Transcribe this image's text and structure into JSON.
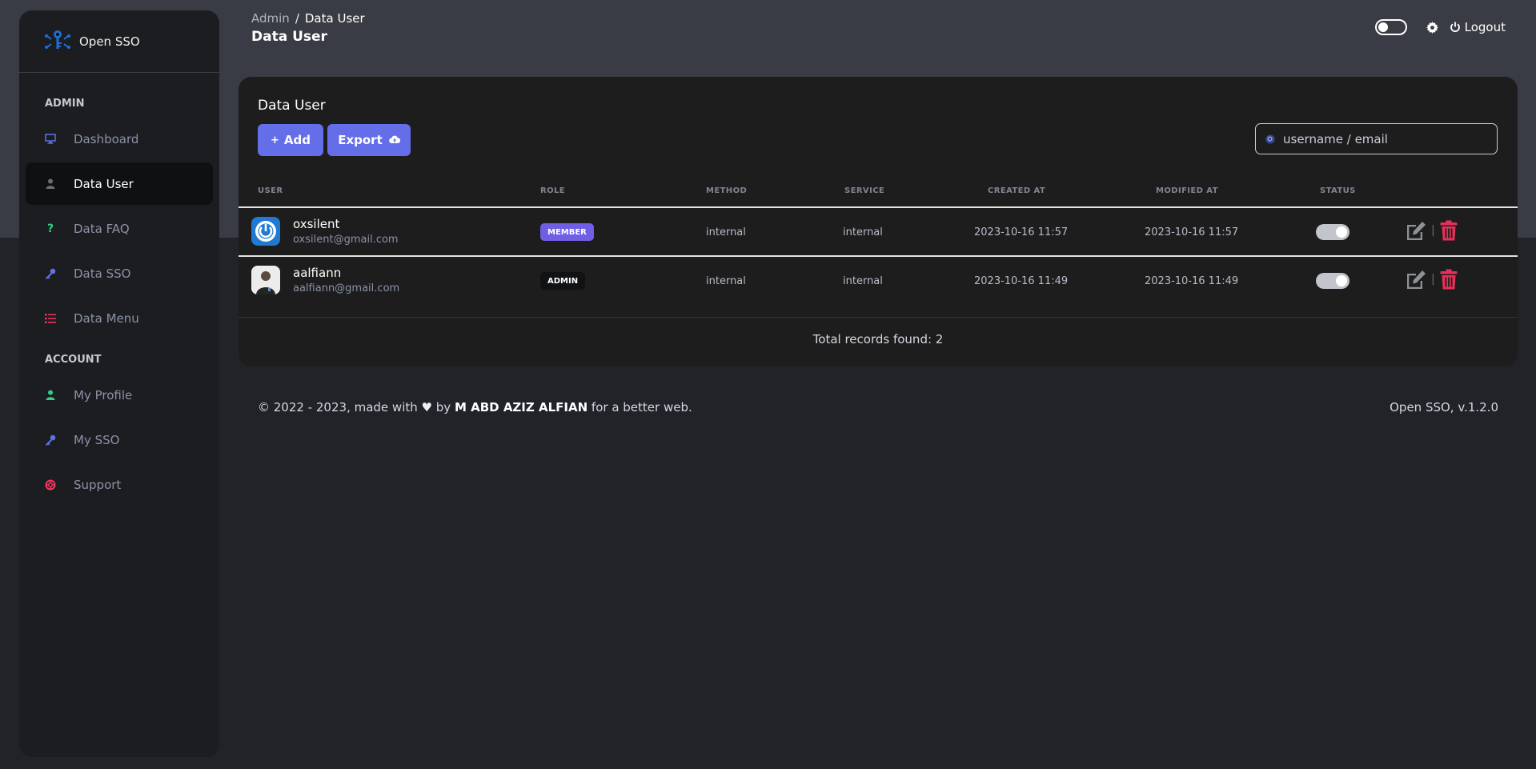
{
  "app": {
    "name": "Open SSO"
  },
  "sidebar": {
    "sections": [
      {
        "title": "ADMIN",
        "items": [
          {
            "label": "Dashboard",
            "icon": "monitor-icon",
            "active": false
          },
          {
            "label": "Data User",
            "icon": "user-icon",
            "active": true
          },
          {
            "label": "Data FAQ",
            "icon": "question-icon",
            "active": false
          },
          {
            "label": "Data SSO",
            "icon": "key-icon",
            "active": false
          },
          {
            "label": "Data Menu",
            "icon": "list-icon",
            "active": false
          }
        ]
      },
      {
        "title": "ACCOUNT",
        "items": [
          {
            "label": "My Profile",
            "icon": "user-icon",
            "active": false
          },
          {
            "label": "My SSO",
            "icon": "key-icon",
            "active": false
          },
          {
            "label": "Support",
            "icon": "lifebuoy-icon",
            "active": false
          }
        ]
      }
    ]
  },
  "header": {
    "breadcrumb": {
      "parent": "Admin",
      "separator": "/",
      "current": "Data User"
    },
    "title": "Data User",
    "logout_label": "Logout"
  },
  "card": {
    "title": "Data User",
    "add_label": "Add",
    "export_label": "Export",
    "search_placeholder": "username / email",
    "columns": [
      "USER",
      "ROLE",
      "METHOD",
      "SERVICE",
      "CREATED AT",
      "MODIFIED AT",
      "STATUS"
    ],
    "rows": [
      {
        "username": "oxsilent",
        "email": "oxsilent@gmail.com",
        "role": "MEMBER",
        "method": "internal",
        "service": "internal",
        "created_at": "2023-10-16 11:57",
        "modified_at": "2023-10-16 11:57",
        "status": true
      },
      {
        "username": "aalfiann",
        "email": "aalfiann@gmail.com",
        "role": "ADMIN",
        "method": "internal",
        "service": "internal",
        "created_at": "2023-10-16 11:49",
        "modified_at": "2023-10-16 11:49",
        "status": true
      }
    ],
    "total_text": "Total records found: 2"
  },
  "footer": {
    "left_prefix": "© 2022 - 2023, made with",
    "left_by": "by",
    "author": "M ABD AZIZ ALFIAN",
    "left_suffix": "for a better web.",
    "right": "Open SSO, v.1.2.0"
  },
  "colors": {
    "accent": "#646ee8",
    "danger": "#e5305a",
    "background": "#212328",
    "card": "#1d1d1e"
  }
}
